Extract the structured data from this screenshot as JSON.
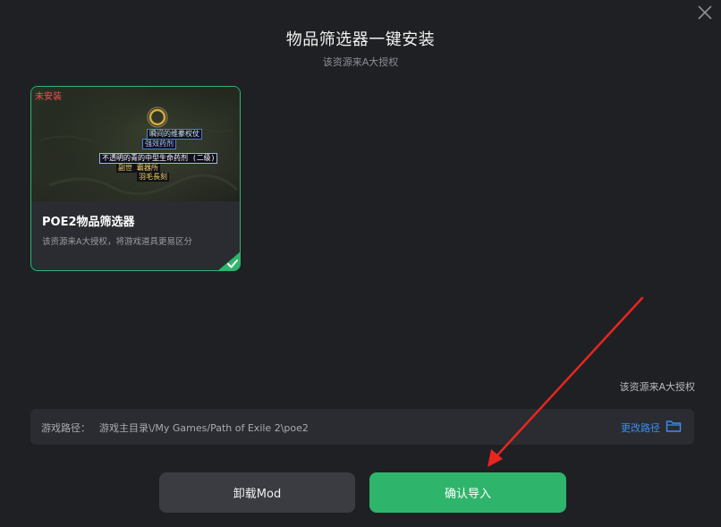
{
  "dialog": {
    "title": "物品筛选器一键安装",
    "subtitle": "该资源来A大授权"
  },
  "card": {
    "status_badge": "未安装",
    "name": "POE2物品筛选器",
    "description": "该资源来A大授权，将游戏道具更易区分",
    "selected": true,
    "thumbnail_labels": [
      "瞬间的维豢权仗",
      "强效药剂",
      "不透明的青的中型生命药剂 (二级)",
      "副世 霸器所",
      "羽毛長刻"
    ]
  },
  "auth_note": "该资源来A大授权",
  "path": {
    "label": "游戏路径：",
    "value": "游戏主目录\\/My Games/Path of Exile 2\\poe2",
    "change_label": "更改路径"
  },
  "buttons": {
    "uninstall": "卸载Mod",
    "confirm": "确认导入"
  },
  "colors": {
    "background": "#1f2024",
    "accent_green": "#2fb56b",
    "link_blue": "#3a8ef0",
    "badge_red": "#ff4d4d",
    "annotation_arrow": "#e8261e"
  },
  "icons": {
    "close": "close-icon",
    "folder": "folder-icon",
    "check": "check-icon"
  }
}
